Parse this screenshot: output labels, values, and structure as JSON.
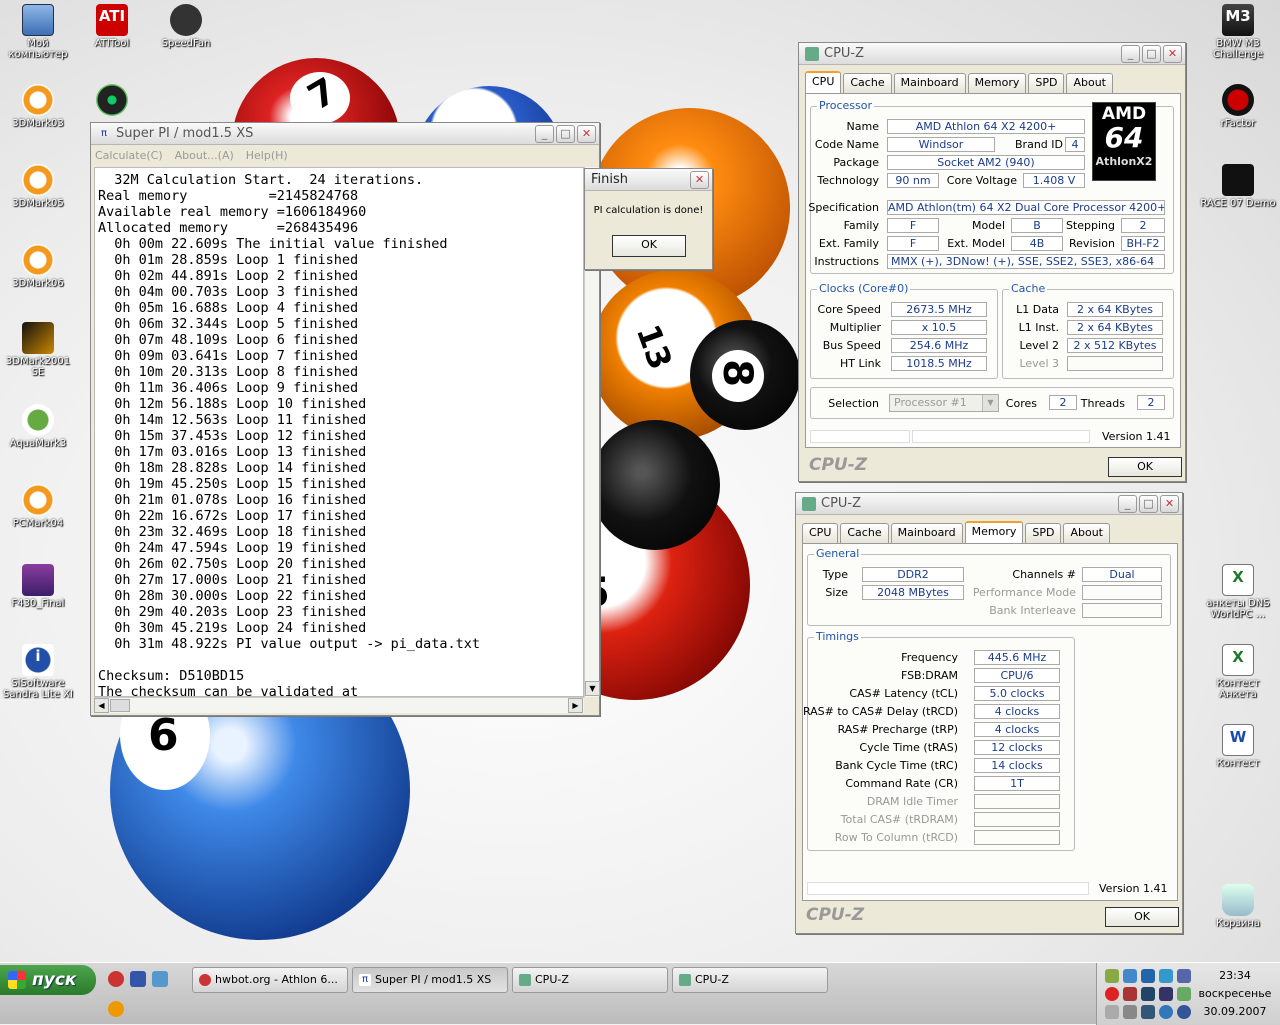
{
  "desktop": {
    "icons_left": [
      {
        "label": "Мой компьютер",
        "type": "pc"
      },
      {
        "label": "ATITool",
        "type": "ati"
      },
      {
        "label": "SpeedFan",
        "type": "fan"
      },
      {
        "label": "3DMark03",
        "type": "orange"
      },
      {
        "label": "3DMark05",
        "type": "orange"
      },
      {
        "label": "3DMark06",
        "type": "orange"
      },
      {
        "label": "3DMark2001 SE",
        "type": "mark01"
      },
      {
        "label": "AquaMark3",
        "type": "aqua"
      },
      {
        "label": "PCMark04",
        "type": "orange"
      },
      {
        "label": "F430_Final",
        "type": "winrar"
      },
      {
        "label": "SiSoftware Sandra Lite XI",
        "type": "sandra"
      }
    ],
    "icons_right": [
      {
        "label": "BMW M3 Challenge",
        "type": "bmw"
      },
      {
        "label": "rFactor",
        "type": "rf"
      },
      {
        "label": "RACE 07 Demo",
        "type": "steam"
      },
      {
        "label": "анкеты DNS WorldPC ...",
        "type": "xls"
      },
      {
        "label": "Контест Анкета",
        "type": "xls"
      },
      {
        "label": "Контест",
        "type": "doc"
      },
      {
        "label": "Корзина",
        "type": "bin"
      }
    ],
    "ball_numbers": [
      "7",
      "13",
      "8",
      "5",
      "6"
    ]
  },
  "superpi": {
    "title": "Super PI / mod1.5 XS",
    "menu": [
      "Calculate(C)",
      "About...(A)",
      "Help(H)"
    ],
    "output": "  32M Calculation Start.  24 iterations.\nReal memory          =2145824768\nAvailable real memory =1606184960\nAllocated memory      =268435496\n  0h 00m 22.609s The initial value finished\n  0h 01m 28.859s Loop 1 finished\n  0h 02m 44.891s Loop 2 finished\n  0h 04m 00.703s Loop 3 finished\n  0h 05m 16.688s Loop 4 finished\n  0h 06m 32.344s Loop 5 finished\n  0h 07m 48.109s Loop 6 finished\n  0h 09m 03.641s Loop 7 finished\n  0h 10m 20.313s Loop 8 finished\n  0h 11m 36.406s Loop 9 finished\n  0h 12m 56.188s Loop 10 finished\n  0h 14m 12.563s Loop 11 finished\n  0h 15m 37.453s Loop 12 finished\n  0h 17m 03.016s Loop 13 finished\n  0h 18m 28.828s Loop 14 finished\n  0h 19m 45.250s Loop 15 finished\n  0h 21m 01.078s Loop 16 finished\n  0h 22m 16.672s Loop 17 finished\n  0h 23m 32.469s Loop 18 finished\n  0h 24m 47.594s Loop 19 finished\n  0h 26m 02.750s Loop 20 finished\n  0h 27m 17.000s Loop 21 finished\n  0h 28m 30.000s Loop 22 finished\n  0h 29m 40.203s Loop 23 finished\n  0h 30m 45.219s Loop 24 finished\n  0h 31m 48.922s PI value output -> pi_data.txt\n\nChecksum: D510BD15\nThe checksum can be validated at"
  },
  "finish": {
    "title": "Finish",
    "message": "PI calculation is done!",
    "ok": "OK"
  },
  "cpuz1": {
    "title": "CPU-Z",
    "tabs": [
      "CPU",
      "Cache",
      "Mainboard",
      "Memory",
      "SPD",
      "About"
    ],
    "processor": {
      "group": "Processor",
      "name_label": "Name",
      "name": "AMD Athlon 64 X2 4200+",
      "code_label": "Code Name",
      "code": "Windsor",
      "brand_label": "Brand ID",
      "brand": "4",
      "package_label": "Package",
      "package": "Socket AM2 (940)",
      "tech_label": "Technology",
      "tech": "90 nm",
      "voltage_label": "Core Voltage",
      "voltage": "1.408 V",
      "spec_label": "Specification",
      "spec": "AMD Athlon(tm) 64 X2 Dual Core Processor 4200+",
      "family_label": "Family",
      "family": "F",
      "model_label": "Model",
      "model": "B",
      "stepping_label": "Stepping",
      "stepping": "2",
      "extfamily_label": "Ext. Family",
      "extfamily": "F",
      "extmodel_label": "Ext. Model",
      "extmodel": "4B",
      "revision_label": "Revision",
      "revision": "BH-F2",
      "instr_label": "Instructions",
      "instr": "MMX (+), 3DNow! (+), SSE, SSE2, SSE3, x86-64",
      "logo_top": "AMD",
      "logo_mid": "64",
      "logo_bottom": "AthlonX2"
    },
    "clocks": {
      "group": "Clocks (Core#0)",
      "speed_label": "Core Speed",
      "speed": "2673.5 MHz",
      "mult_label": "Multiplier",
      "mult": "x 10.5",
      "bus_label": "Bus Speed",
      "bus": "254.6 MHz",
      "ht_label": "HT Link",
      "ht": "1018.5 MHz"
    },
    "cache": {
      "group": "Cache",
      "l1d_label": "L1 Data",
      "l1d": "2 x 64 KBytes",
      "l1i_label": "L1 Inst.",
      "l1i": "2 x 64 KBytes",
      "l2_label": "Level 2",
      "l2": "2 x 512 KBytes",
      "l3_label": "Level 3",
      "l3": ""
    },
    "selection_label": "Selection",
    "selection": "Processor #1",
    "cores_label": "Cores",
    "cores": "2",
    "threads_label": "Threads",
    "threads": "2",
    "version": "Version 1.41",
    "brand": "CPU-Z",
    "ok": "OK"
  },
  "cpuz2": {
    "title": "CPU-Z",
    "tabs": [
      "CPU",
      "Cache",
      "Mainboard",
      "Memory",
      "SPD",
      "About"
    ],
    "general": {
      "group": "General",
      "type_label": "Type",
      "type": "DDR2",
      "size_label": "Size",
      "size": "2048 MBytes",
      "channels_label": "Channels #",
      "channels": "Dual",
      "perf_label": "Performance Mode",
      "perf": "",
      "bank_label": "Bank Interleave",
      "bank": ""
    },
    "timings": {
      "group": "Timings",
      "rows": [
        {
          "label": "Frequency",
          "value": "445.6 MHz",
          "dim": false
        },
        {
          "label": "FSB:DRAM",
          "value": "CPU/6",
          "dim": false
        },
        {
          "label": "CAS# Latency (tCL)",
          "value": "5.0 clocks",
          "dim": false
        },
        {
          "label": "RAS# to CAS# Delay (tRCD)",
          "value": "4 clocks",
          "dim": false
        },
        {
          "label": "RAS# Precharge (tRP)",
          "value": "4 clocks",
          "dim": false
        },
        {
          "label": "Cycle Time (tRAS)",
          "value": "12 clocks",
          "dim": false
        },
        {
          "label": "Bank Cycle Time (tRC)",
          "value": "14 clocks",
          "dim": false
        },
        {
          "label": "Command Rate (CR)",
          "value": "1T",
          "dim": false
        },
        {
          "label": "DRAM Idle Timer",
          "value": "",
          "dim": true
        },
        {
          "label": "Total CAS# (tRDRAM)",
          "value": "",
          "dim": true
        },
        {
          "label": "Row To Column (tRCD)",
          "value": "",
          "dim": true
        }
      ]
    },
    "version": "Version 1.41",
    "brand": "CPU-Z",
    "ok": "OK"
  },
  "taskbar": {
    "start": "пуск",
    "buttons": [
      {
        "label": "hwbot.org - Athlon 6...",
        "active": false
      },
      {
        "label": "Super PI / mod1.5 XS",
        "active": true
      },
      {
        "label": "CPU-Z",
        "active": false
      },
      {
        "label": "CPU-Z",
        "active": false
      }
    ],
    "time": "23:34",
    "day": "воскресенье",
    "date": "30.09.2007"
  }
}
